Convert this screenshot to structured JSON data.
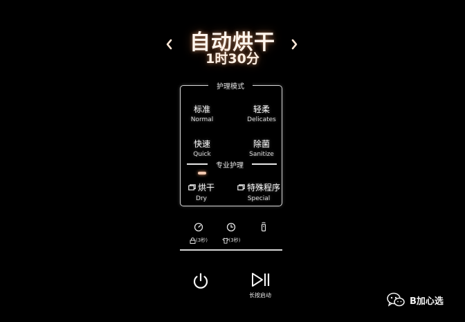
{
  "header": {
    "mode_title": "自动烘干",
    "remaining_time": "1时30分",
    "prev_icon": "chevron-left-icon",
    "next_icon": "chevron-right-icon"
  },
  "care_panel": {
    "title": "护理模式",
    "options": [
      {
        "cn": "标准",
        "en": "Normal"
      },
      {
        "cn": "轻柔",
        "en": "Delicates"
      },
      {
        "cn": "快速",
        "en": "Quick"
      },
      {
        "cn": "除菌",
        "en": "Sanitize"
      }
    ],
    "pro_title": "专业护理",
    "special": [
      {
        "cn": "烘干",
        "en": "Dry",
        "icon": "window-icon"
      },
      {
        "cn": "特殊程序",
        "en": "Special",
        "icon": "window-icon"
      }
    ]
  },
  "utilities": {
    "child_lock": {
      "label": "(3秒)",
      "icon": "child-lock-icon"
    },
    "timer": {
      "label": "(3秒)",
      "icon": "timer-icon"
    },
    "smart": {
      "icon": "smart-control-icon"
    }
  },
  "controls": {
    "power_icon": "power-icon",
    "start_icon": "play-pause-icon",
    "start_label": "长按启动"
  },
  "watermark": {
    "text": "B加心选",
    "icon": "wechat-icon"
  },
  "colors": {
    "background": "#000000",
    "text": "#f4f4f4",
    "glow": "#ffbe8c",
    "indicator": "#f0c8b0"
  }
}
